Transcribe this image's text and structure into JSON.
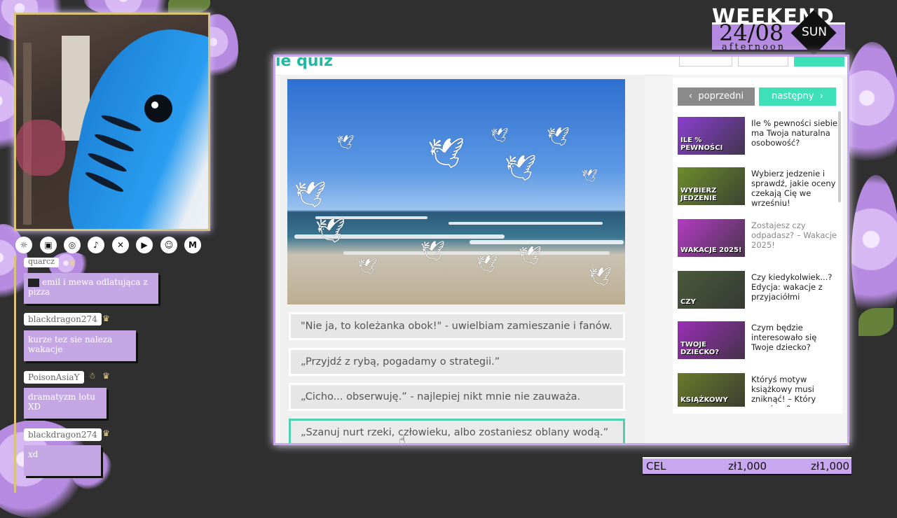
{
  "social_icons": [
    {
      "icon": "streamer-logo-icon",
      "glyph": "☼"
    },
    {
      "icon": "twitch-icon",
      "glyph": "▣"
    },
    {
      "icon": "instagram-icon",
      "glyph": "◎"
    },
    {
      "icon": "tiktok-icon",
      "glyph": "♪"
    },
    {
      "icon": "x-icon",
      "glyph": "✕"
    },
    {
      "icon": "youtube-icon",
      "glyph": "▶"
    },
    {
      "icon": "discord-icon",
      "glyph": "☺"
    },
    {
      "icon": "gmail-icon",
      "glyph": "M"
    }
  ],
  "chat": [
    {
      "user": "quarcz",
      "message": "emil i mewa odlatująca z pizza"
    },
    {
      "user": "blackdragon274",
      "message": "kurze tez sie naleza wakacje"
    },
    {
      "user": "PoisonAsiaY",
      "message": "dramatyzm lotu XD"
    },
    {
      "user": "blackdragon274",
      "message": "xd"
    }
  ],
  "logo": {
    "top": "WEEKEND",
    "date": "24/08",
    "day": "SUN",
    "sub": "afternoon"
  },
  "quiz": {
    "logo_text": "ie quiz",
    "answers": [
      "\"Nie ja, to koleżanka obok!\" - uwielbiam zamieszanie i fanów.",
      "„Przyjdź z rybą, pogadamy o strategii.”",
      "„Cicho... obserwuję.” - najlepiej nikt mnie nie zauważa.",
      "„Szanuj nurt rzeki, człowieku, albo zostaniesz oblany wodą.”"
    ]
  },
  "sidebar": {
    "prev_label": "poprzedni",
    "next_label": "następny",
    "related": [
      {
        "title": "Ile % pewności siebie ma Twoja naturalna osobowość?",
        "thumb_text": "ILE % PEWNOŚCI",
        "color": "#8b3fd1"
      },
      {
        "title": "Wybierz jedzenie i sprawdź, jakie oceny czekają Cię we wrześniu!",
        "thumb_text": "WYBIERZ JEDZENIE",
        "color": "#6d8d2c"
      },
      {
        "title": "Zostajesz czy odpadasz? – Wakacje 2025!",
        "thumb_text": "WAKACJE 2025!",
        "color": "#b43cc4"
      },
      {
        "title": "Czy kiedykolwiek...? Edycja: wakacje z przyjaciółmi",
        "thumb_text": "CZY",
        "color": "#4a5a3a"
      },
      {
        "title": "Czym będzie interesowało się Twoje dziecko?",
        "thumb_text": "TWOJE DZIECKO?",
        "color": "#9a2fb8"
      },
      {
        "title": "Któryś motyw książkowy musi zniknąć! – Który usuniesz?",
        "thumb_text": "KSIĄŻKOWY",
        "color": "#6b7a2a"
      }
    ]
  },
  "goal": {
    "label": "CEL",
    "current": "zł1,000",
    "target": "zł1,000"
  }
}
